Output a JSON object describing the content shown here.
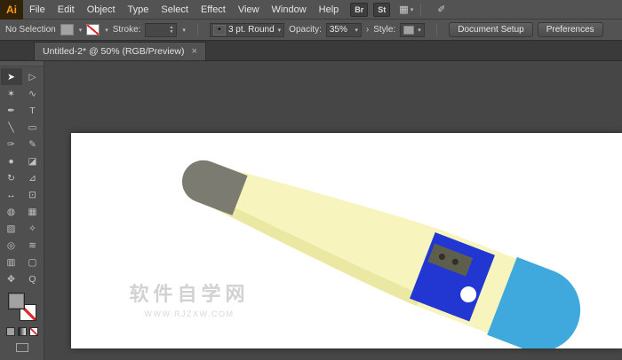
{
  "menu_bar": {
    "logo": "Ai",
    "items": [
      "File",
      "Edit",
      "Object",
      "Type",
      "Select",
      "Effect",
      "View",
      "Window",
      "Help"
    ],
    "bridge_label": "Br",
    "stock_label": "St",
    "icons": {
      "arrange_documents": "▦",
      "caret": "▾",
      "workspace": "✐"
    }
  },
  "control_bar": {
    "selection_status": "No Selection",
    "stroke_label": "Stroke:",
    "stepper_up": "▲",
    "stepper_down": "▼",
    "caret": "▾",
    "brush_preview_glyph": "•",
    "brush_name": "3 pt. Round",
    "opacity_label": "Opacity:",
    "opacity_value": "35%",
    "overflow_chevron": "›",
    "style_label": "Style:",
    "document_setup_label": "Document Setup",
    "preferences_label": "Preferences"
  },
  "tab_bar": {
    "active_tab_title": "Untitled-2* @ 50% (RGB/Preview)",
    "close_glyph": "×"
  },
  "toolbar": {
    "tools": [
      {
        "name": "selection-tool",
        "glyph": "➤"
      },
      {
        "name": "direct-selection-tool",
        "glyph": "▷"
      },
      {
        "name": "magic-wand-tool",
        "glyph": "✶"
      },
      {
        "name": "lasso-tool",
        "glyph": "∿"
      },
      {
        "name": "pen-tool",
        "glyph": "✒"
      },
      {
        "name": "type-tool",
        "glyph": "T"
      },
      {
        "name": "line-segment-tool",
        "glyph": "╲"
      },
      {
        "name": "rectangle-tool",
        "glyph": "▭"
      },
      {
        "name": "paintbrush-tool",
        "glyph": "✑"
      },
      {
        "name": "pencil-tool",
        "glyph": "✎"
      },
      {
        "name": "blob-brush-tool",
        "glyph": "●"
      },
      {
        "name": "eraser-tool",
        "glyph": "◪"
      },
      {
        "name": "rotate-tool",
        "glyph": "↻"
      },
      {
        "name": "scale-tool",
        "glyph": "⊿"
      },
      {
        "name": "width-tool",
        "glyph": "↔"
      },
      {
        "name": "free-transform-tool",
        "glyph": "⊡"
      },
      {
        "name": "shape-builder-tool",
        "glyph": "◍"
      },
      {
        "name": "mesh-tool",
        "glyph": "▦"
      },
      {
        "name": "gradient-tool",
        "glyph": "▧"
      },
      {
        "name": "eyedropper-tool",
        "glyph": "✧"
      },
      {
        "name": "blend-tool",
        "glyph": "◎"
      },
      {
        "name": "symbol-sprayer-tool",
        "glyph": "≋"
      },
      {
        "name": "column-graph-tool",
        "glyph": "▥"
      },
      {
        "name": "artboard-tool",
        "glyph": "▢"
      },
      {
        "name": "hand-tool",
        "glyph": "✥"
      },
      {
        "name": "zoom-tool",
        "glyph": "Q"
      }
    ]
  },
  "canvas": {
    "watermark_title": "软件自学网",
    "watermark_url": "WWW.RJZXW.COM"
  },
  "artwork": {
    "tip_color": "#7b7b72",
    "body_color": "#f7f4bd",
    "body_shade_color": "#ebe8a3",
    "band_color": "#2237d2",
    "panel_color": "#5e5e4d",
    "panel_dot_color": "#30302a",
    "button_color": "#ffffff",
    "cap_color": "#3fa9dd"
  }
}
